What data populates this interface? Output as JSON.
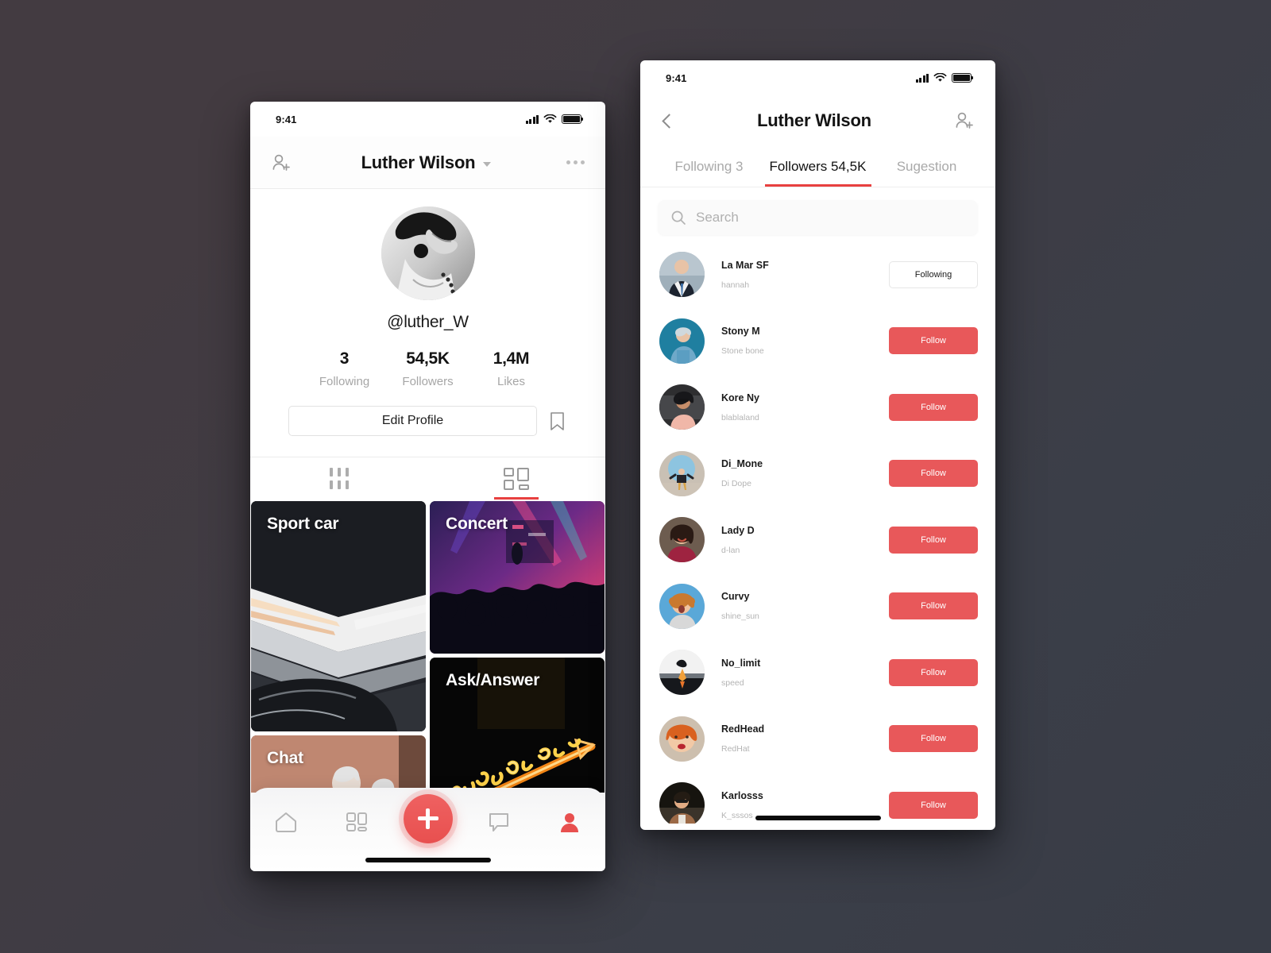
{
  "theme": {
    "accent_red": "#E8585A",
    "fab_red": "#E8504F",
    "bg_dark_warm": "#433B41",
    "bg_dark_cool": "#383C46"
  },
  "profile_screen": {
    "status_bar": {
      "time": "9:41"
    },
    "nav": {
      "add_user_icon": "add-person-icon",
      "title": "Luther Wilson",
      "dropdown_icon": "chevron-down-icon",
      "more_icon": "more-horizontal-icon"
    },
    "avatar_alt": "profile-photo",
    "handle": "@luther_W",
    "stats": [
      {
        "value": "3",
        "label": "Following"
      },
      {
        "value": "54,5K",
        "label": "Followers"
      },
      {
        "value": "1,4M",
        "label": "Likes"
      }
    ],
    "edit_profile_label": "Edit Profile",
    "bookmark_icon": "bookmark-icon",
    "view_tabs": [
      {
        "icon": "list-columns-icon",
        "active": false
      },
      {
        "icon": "mosaic-grid-icon",
        "active": true
      }
    ],
    "cards": [
      {
        "title": "Sport car",
        "art": "sportcar"
      },
      {
        "title": "Chat",
        "art": "chat"
      },
      {
        "title": "Concert",
        "art": "concert"
      },
      {
        "title": "Ask/Answer",
        "art": "ask"
      }
    ],
    "tabbar": [
      {
        "icon": "home-icon",
        "active": false
      },
      {
        "icon": "grid-icon",
        "active": false
      },
      {
        "icon": "plus-icon",
        "active": true
      },
      {
        "icon": "comment-icon",
        "active": false
      },
      {
        "icon": "person-icon",
        "active": true
      }
    ]
  },
  "followers_screen": {
    "status_bar": {
      "time": "9:41"
    },
    "nav": {
      "back_icon": "chevron-left-icon",
      "title": "Luther Wilson",
      "add_user_icon": "add-person-icon"
    },
    "tabs": [
      {
        "label": "Following 3",
        "active": false
      },
      {
        "label": "Followers 54,5K",
        "active": true
      },
      {
        "label": "Sugestion",
        "active": false
      }
    ],
    "search": {
      "placeholder": "Search",
      "value": "",
      "icon": "search-icon"
    },
    "followers": [
      {
        "name": "La Mar SF",
        "handle": "hannah",
        "action": "Following",
        "following": true,
        "art": "suit-man"
      },
      {
        "name": "Stony M",
        "handle": "Stone bone",
        "action": "Follow",
        "following": false,
        "art": "denim-woman"
      },
      {
        "name": "Kore Ny",
        "handle": "blablaland",
        "action": "Follow",
        "following": false,
        "art": "curly-woman"
      },
      {
        "name": "Di_Mone",
        "handle": "Di Dope",
        "action": "Follow",
        "following": false,
        "art": "sky-man"
      },
      {
        "name": "Lady D",
        "handle": "d-lan",
        "action": "Follow",
        "following": false,
        "art": "red-sweater"
      },
      {
        "name": "Curvy",
        "handle": "shine_sun",
        "action": "Follow",
        "following": false,
        "art": "blue-bg-woman"
      },
      {
        "name": "No_limit",
        "handle": "speed",
        "action": "Follow",
        "following": false,
        "art": "jumper"
      },
      {
        "name": "RedHead",
        "handle": "RedHat",
        "action": "Follow",
        "following": false,
        "art": "redhead"
      },
      {
        "name": "Karlosss",
        "handle": "K_sssos",
        "action": "Follow",
        "following": false,
        "art": "sunglasses-man"
      }
    ]
  }
}
